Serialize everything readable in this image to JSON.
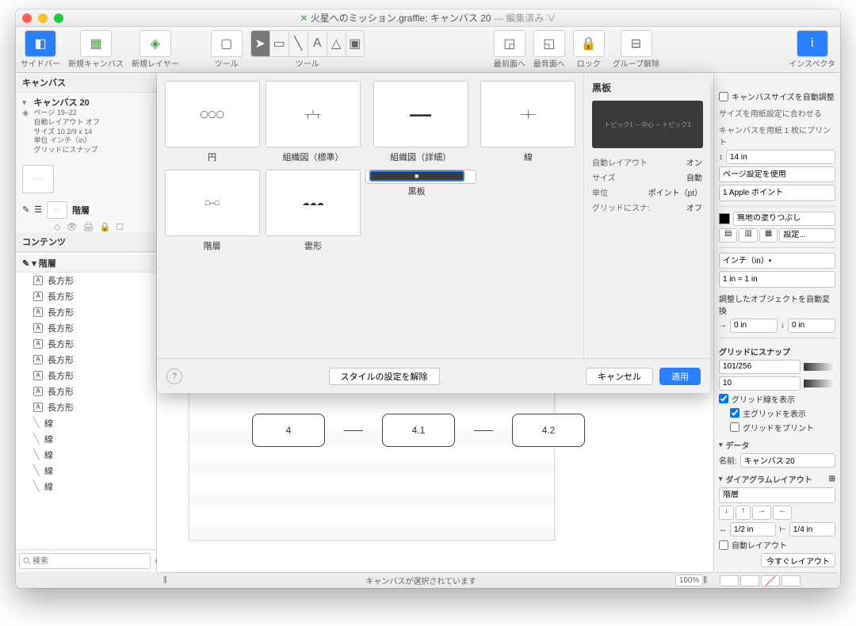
{
  "window": {
    "title_doc": "火星へのミッション.graffle:",
    "title_canvas": "キャンバス 20",
    "title_edited": "— 編集済み ∨"
  },
  "toolbar": {
    "sidebar": "サイドバー",
    "new_canvas": "新規キャンバス",
    "new_layer": "新規レイヤー",
    "tool": "ツール",
    "tool2": "ツール",
    "front": "最前面へ",
    "back": "最背面へ",
    "lock": "ロック",
    "ungroup": "グループ解除",
    "inspector": "インスペクタ"
  },
  "sidebar": {
    "canvas_header": "キャンバス",
    "canvas_name": "キャンバス 20",
    "pages": "ページ 19–22",
    "detail1": "自動レイアウト オフ",
    "detail2": "サイズ 10 2/9 x 14",
    "detail3": "単位 インチ（in）",
    "detail4": "グリッドにスナップ",
    "layer": "階層",
    "contents": "コンテンツ",
    "top_item": "階層",
    "rect_label": "長方形",
    "line_label": "線",
    "search_placeholder": "検索"
  },
  "outline": {
    "rects": [
      "長方形",
      "長方形",
      "長方形",
      "長方形",
      "長方形",
      "長方形",
      "長方形",
      "長方形",
      "長方形"
    ],
    "lines": [
      "線",
      "線",
      "線",
      "線",
      "線"
    ]
  },
  "canvas": {
    "boxes": [
      "4",
      "4.1",
      "4.2"
    ]
  },
  "modal": {
    "tiles": [
      {
        "label": "円"
      },
      {
        "label": "組織図（標準）"
      },
      {
        "label": "組織図（詳細）"
      },
      {
        "label": "線"
      },
      {
        "label": "階層"
      },
      {
        "label": "雲形"
      },
      {
        "label": "黒板",
        "selected": true
      }
    ],
    "side_title": "黒板",
    "kv": [
      {
        "k": "自動レイアウト",
        "v": "オン"
      },
      {
        "k": "サイズ",
        "v": "自動"
      },
      {
        "k": "単位",
        "v": "ポイント（pt）"
      },
      {
        "k": "グリッドにスナ:",
        "v": "オフ"
      }
    ],
    "reset": "スタイルの設定を解除",
    "cancel": "キャンセル",
    "apply": "適用"
  },
  "inspector": {
    "auto_size": "キャンバスサイズを自動調整",
    "fit_paper": "サイズを用紙設定に合わせる",
    "print_one": "キャンバスを用紙 1 枚にプリント",
    "height": "14 in",
    "use_page": "ページ設定を使用",
    "apple_pt": "1 Apple ポイント",
    "fill": "無地の塗りつぶし",
    "settings": "設定...",
    "unit": "インチ（in）•",
    "scale": "1 in = 1 in",
    "auto_convert": "調整したオブジェクトを自動変換",
    "zero": "0 in",
    "snap": "グリッドにスナップ",
    "grid1": "101/256",
    "grid2": "10",
    "show_grid": "グリッド線を表示",
    "show_main": "主グリッドを表示",
    "print_grid": "グリッドをプリント",
    "data": "データ",
    "name_lbl": "名前:",
    "name_val": "キャンバス 20",
    "diagram": "ダイアグラムレイアウト",
    "layer_sel": "階層",
    "sp1": "1/2 in",
    "sp2": "1/4 in",
    "auto_layout": "自動レイアウト",
    "layout_now": "今すぐレイアウト"
  },
  "status": {
    "text": "キャンバスが選択されています",
    "zoom": "100%"
  }
}
